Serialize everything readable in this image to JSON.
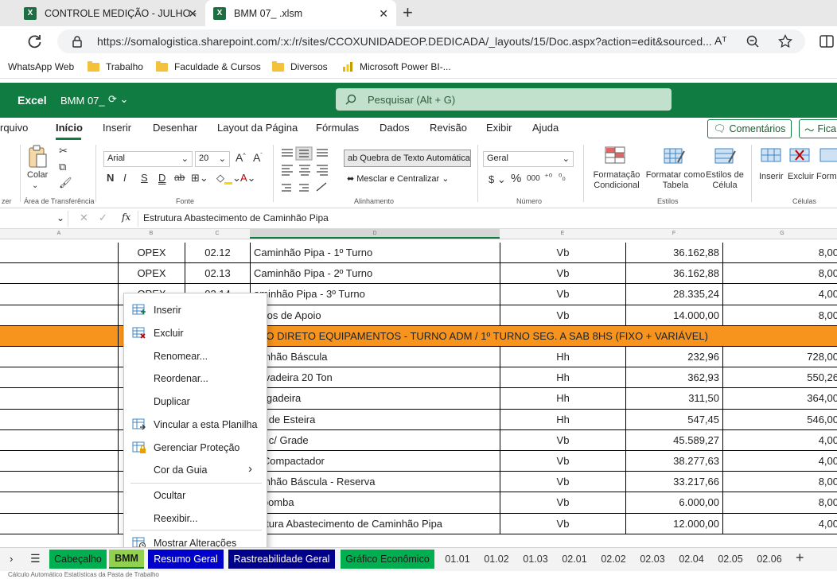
{
  "browser": {
    "tabs": [
      {
        "label": "CONTROLE MEDIÇÃO - JULHO -",
        "active": false
      },
      {
        "label": "BMM 07_ .xlsm",
        "active": true
      }
    ],
    "new_tab": "+",
    "url": "https://somalogistica.sharepoint.com/:x:/r/sites/CCOXUNIDADEOP.DEDICADA/_layouts/15/Doc.aspx?action=edit&sourced...",
    "reader_icon": "Aᵀ"
  },
  "bookmarks": [
    {
      "label": "WhatsApp Web",
      "icon": "whatsapp-icon"
    },
    {
      "label": "Trabalho",
      "icon": "folder-icon"
    },
    {
      "label": "Faculdade & Cursos",
      "icon": "folder-icon"
    },
    {
      "label": "Diversos",
      "icon": "folder-icon"
    },
    {
      "label": "Microsoft Power BI-...",
      "icon": "powerbi-icon"
    }
  ],
  "excel": {
    "app": "Excel",
    "file": "BMM 07_",
    "search_placeholder": "Pesquisar (Alt + G)"
  },
  "ribbon_tabs": [
    "rquivo",
    "Início",
    "Inserir",
    "Desenhar",
    "Layout da Página",
    "Fórmulas",
    "Dados",
    "Revisão",
    "Exibir",
    "Ajuda"
  ],
  "ribbon_active": "Início",
  "comments_button": "Comentários",
  "fica_button": "Fica",
  "ribbon": {
    "clipboard": {
      "paste": "Colar",
      "group": "Área de Transferência",
      "prev_group": "zer"
    },
    "font": {
      "name": "Arial",
      "size": "20",
      "bold": "N",
      "italic": "I",
      "underline": "S",
      "dunder": "D",
      "strike": "ab",
      "group": "Fonte"
    },
    "alignment": {
      "wrap": "Quebra de Texto Automática",
      "merge": "Mesclar e Centralizar",
      "group": "Alinhamento"
    },
    "number": {
      "format": "Geral",
      "currency": "$",
      "percent": "%",
      "thousands": "000",
      "group": "Número"
    },
    "styles": {
      "cond": "Formatação Condicional",
      "table": "Formatar como Tabela",
      "cell": "Estilos de Célula",
      "group": "Estilos"
    },
    "cells": {
      "insert": "Inserir",
      "delete": "Excluir",
      "format": "Forma",
      "group": "Células"
    }
  },
  "formula_bar": {
    "fx": "fx",
    "content": "Estrutura Abastecimento de Caminhão Pipa"
  },
  "columns": [
    "A",
    "B",
    "C",
    "D",
    "E",
    "F",
    "G"
  ],
  "rows": [
    {
      "b": "OPEX",
      "c": "02.12",
      "d": "Caminhão Pipa - 1º Turno",
      "e": "Vb",
      "f": "36.162,88",
      "g": "8,00"
    },
    {
      "b": "OPEX",
      "c": "02.13",
      "d": "Caminhão Pipa - 2º Turno",
      "e": "Vb",
      "f": "36.162,88",
      "g": "8,00"
    },
    {
      "b": "OPEX",
      "c": "02.14",
      "d": "aminhão Pipa - 3º Turno",
      "e": "Vb",
      "f": "28.335,24",
      "g": "4,00"
    },
    {
      "b": "",
      "c": "",
      "d": "culos de Apoio",
      "e": "Vb",
      "f": "14.000,00",
      "g": "8,00"
    },
    {
      "b": "",
      "c": "",
      "d": "STO DIRETO EQUIPAMENTOS - TURNO ADM / 1º TURNO SEG. A SAB 8HS (FIXO + VARIÁVEL)",
      "e": "",
      "f": "",
      "g": "",
      "section": true
    },
    {
      "b": "",
      "c": "",
      "d": "minhão Báscula",
      "e": "Hh",
      "f": "232,96",
      "g": "728,00"
    },
    {
      "b": "",
      "c": "",
      "d": "cavadeira 20 Ton",
      "e": "Hh",
      "f": "362,93",
      "g": "550,26"
    },
    {
      "b": "",
      "c": "",
      "d": "rregadeira",
      "e": "Hh",
      "f": "311,50",
      "g": "364,00"
    },
    {
      "b": "",
      "c": "",
      "d": "tor de Esteira",
      "e": "Hh",
      "f": "547,45",
      "g": "546,00"
    },
    {
      "b": "",
      "c": "",
      "d": "tor c/ Grade",
      "e": "Vb",
      "f": "45.589,27",
      "g": "4,00"
    },
    {
      "b": "",
      "c": "",
      "d": "o Compactador",
      "e": "Vb",
      "f": "38.277,63",
      "g": "4,00"
    },
    {
      "b": "",
      "c": "",
      "d": "minhão Báscula - Reserva",
      "e": "Vb",
      "f": "33.217,66",
      "g": "8,00"
    },
    {
      "b": "",
      "c": "",
      "d": "tobomba",
      "e": "Vb",
      "f": "6.000,00",
      "g": "8,00"
    },
    {
      "b": "",
      "c": "",
      "d": "trutura Abastecimento de Caminhão Pipa",
      "e": "Vb",
      "f": "12.000,00",
      "g": "4,00"
    }
  ],
  "context_menu": [
    {
      "label": "Inserir",
      "icon": "insert-sheet-icon"
    },
    {
      "label": "Excluir",
      "icon": "delete-sheet-icon"
    },
    {
      "label": "Renomear...",
      "icon": ""
    },
    {
      "label": "Reordenar...",
      "icon": ""
    },
    {
      "label": "Duplicar",
      "icon": ""
    },
    {
      "label": "Vincular a esta Planilha",
      "icon": "link-sheet-icon"
    },
    {
      "label": "Gerenciar Proteção",
      "icon": "protect-sheet-icon"
    },
    {
      "label": "Cor da Guia",
      "icon": "",
      "submenu": true
    },
    {
      "label": "Ocultar",
      "icon": ""
    },
    {
      "label": "Reexibir...",
      "icon": ""
    },
    {
      "label": "Mostrar Alterações",
      "icon": "show-changes-icon"
    }
  ],
  "sheet_tabs": [
    {
      "label": "Cabeçalho",
      "bg": "#00b050",
      "fg": "#1a1a1a"
    },
    {
      "label": "BMM",
      "bg": "#92d050",
      "fg": "#1a1a1a",
      "active": true
    },
    {
      "label": "Resumo Geral",
      "bg": "#0000cc",
      "fg": "#ffffff"
    },
    {
      "label": "Rastreabilidade Geral",
      "bg": "#00008b",
      "fg": "#ffffff"
    },
    {
      "label": "Gráfico Econômico",
      "bg": "#00b050",
      "fg": "#1a1a1a"
    },
    {
      "label": "01.01",
      "bg": "",
      "fg": "#333"
    },
    {
      "label": "01.02",
      "bg": "",
      "fg": "#333"
    },
    {
      "label": "01.03",
      "bg": "",
      "fg": "#333"
    },
    {
      "label": "02.01",
      "bg": "",
      "fg": "#333"
    },
    {
      "label": "02.02",
      "bg": "",
      "fg": "#333"
    },
    {
      "label": "02.03",
      "bg": "",
      "fg": "#333"
    },
    {
      "label": "02.04",
      "bg": "",
      "fg": "#333"
    },
    {
      "label": "02.05",
      "bg": "",
      "fg": "#333"
    },
    {
      "label": "02.06",
      "bg": "",
      "fg": "#333"
    }
  ],
  "status_text": "Cálculo Automático   Estatísticas da Pasta de Trabalho",
  "colors": {
    "excel_green": "#107c41",
    "section_orange": "#f7941d"
  }
}
